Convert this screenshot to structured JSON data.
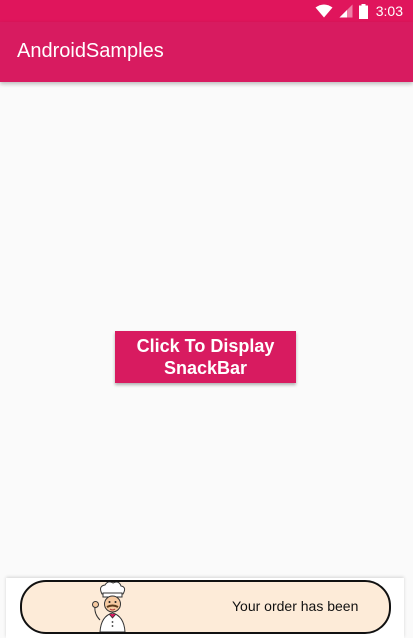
{
  "status_bar": {
    "time": "3:03",
    "icons": [
      "wifi-icon",
      "signal-icon",
      "battery-icon"
    ],
    "color": "#e0155c"
  },
  "app_bar": {
    "title": "AndroidSamples",
    "color": "#d81b60"
  },
  "main": {
    "button_line1": "Click To Display",
    "button_line2": "SnackBar"
  },
  "snackbar": {
    "message": "Your order has been",
    "icon": "chef-icon",
    "background": "#fdebd8"
  }
}
